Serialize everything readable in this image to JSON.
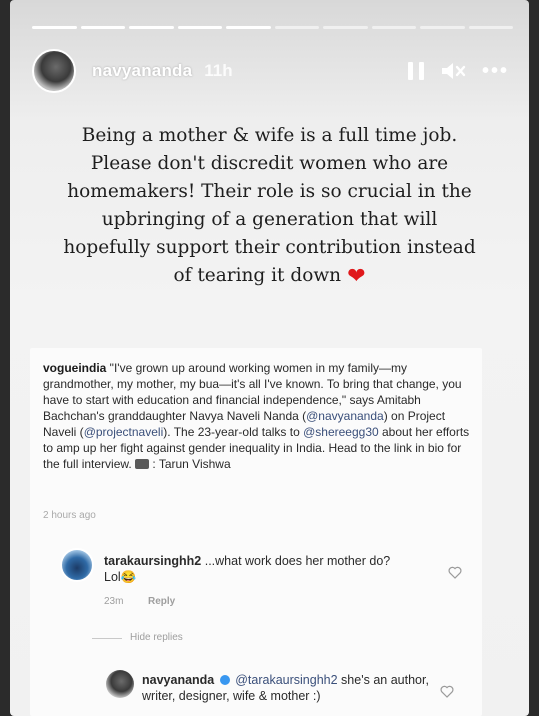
{
  "story": {
    "progress_segments": [
      true,
      true,
      true,
      true,
      true,
      false,
      false,
      false,
      false,
      false
    ],
    "username": "navyananda",
    "time": "11h",
    "more_label": "•••",
    "caption_lines": [
      "Being a mother & wife is a full time job.",
      "Please don't discredit women who are",
      "homemakers! Their role is so crucial in the",
      "upbringing of a generation that will",
      "hopefully support their contribution instead",
      "of tearing it down"
    ],
    "heart": "❤"
  },
  "post": {
    "author": "vogueindia",
    "caption_1": " \"I've grown up around working women in my family—my grandmother, my mother, my bua—it's all I've known. To bring that change, you have to start with education and financial independence,\" says Amitabh Bachchan's granddaughter Navya Naveli Nanda (",
    "mention_1": "@navyananda",
    "caption_2": ") on Project Naveli (",
    "mention_2": "@projectnaveli",
    "caption_3": "). The 23-year-old talks to ",
    "mention_3": "@shereegg30",
    "caption_4": " about her efforts to amp up her fight against gender inequality in India. Head to the link in bio for the full interview. ",
    "caption_5": " : Tarun Vishwa",
    "time": "2 hours ago"
  },
  "comments": [
    {
      "username": "tarakaursinghh2",
      "text": " ...what work does her mother do? Lol😂",
      "time": "23m",
      "reply_label": "Reply"
    }
  ],
  "hide_replies_label": "Hide replies",
  "reply": {
    "username": "navyananda",
    "mention": "@tarakaursinghh2",
    "text": " she's an author, writer, designer, wife & mother :)"
  }
}
